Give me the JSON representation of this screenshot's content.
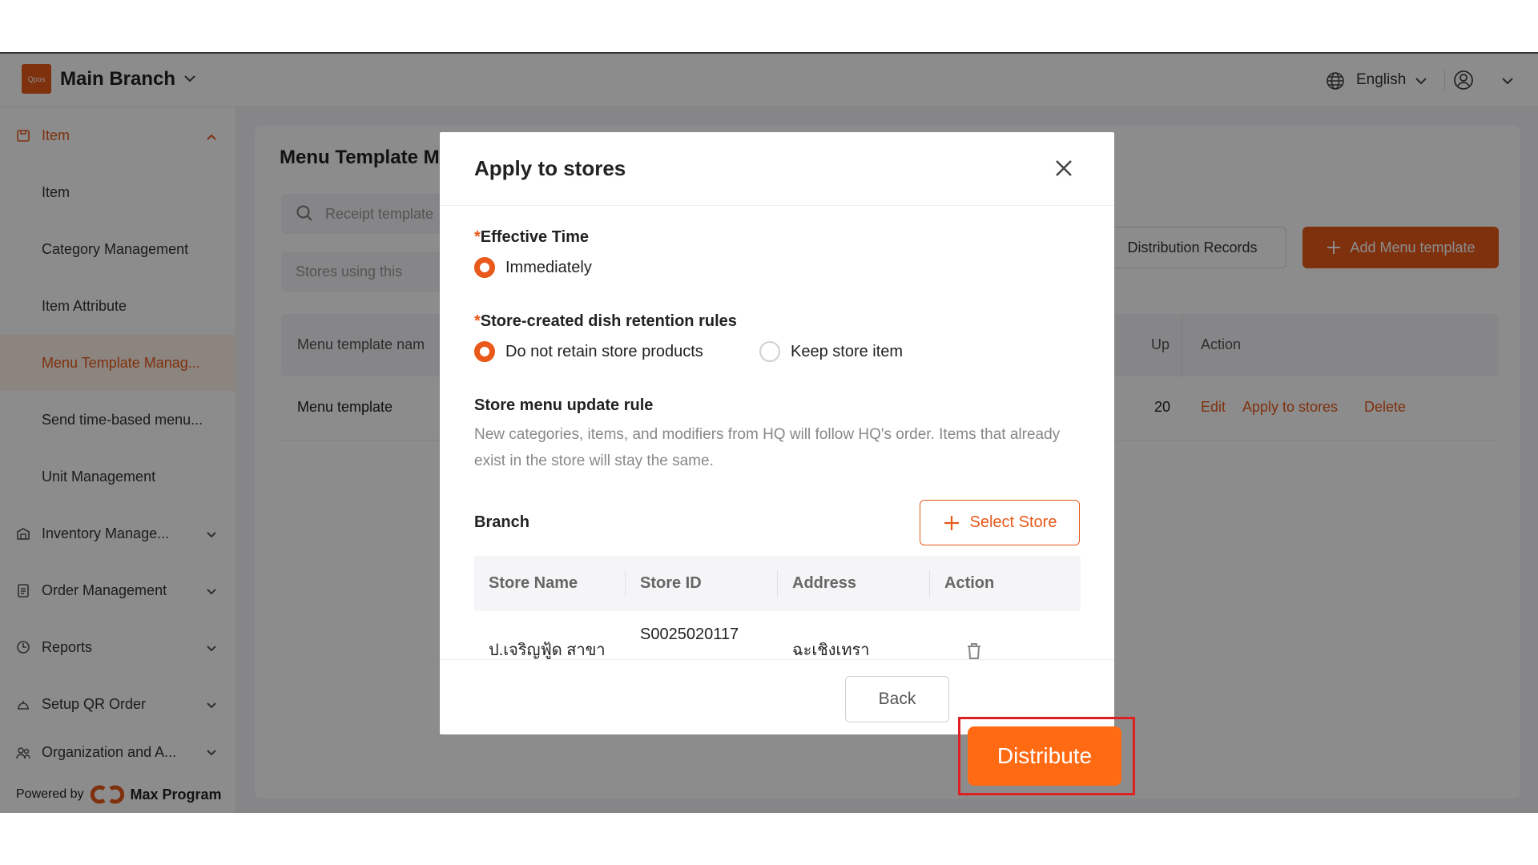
{
  "topbar": {
    "logo_text": "Qpos",
    "branch": "Main Branch",
    "language": "English"
  },
  "sidebar": {
    "items": [
      {
        "label": "Item",
        "icon": "item-icon"
      },
      {
        "label": "Item"
      },
      {
        "label": "Category Management"
      },
      {
        "label": "Item Attribute"
      },
      {
        "label": "Menu Template Manag..."
      },
      {
        "label": "Send time-based menu..."
      },
      {
        "label": "Unit Management"
      },
      {
        "label": "Inventory Manage...",
        "icon": "inventory-icon"
      },
      {
        "label": "Order Management",
        "icon": "order-icon"
      },
      {
        "label": "Reports",
        "icon": "reports-icon"
      },
      {
        "label": "Setup QR Order",
        "icon": "qr-order-icon"
      },
      {
        "label": "Organization and A...",
        "icon": "organization-icon"
      }
    ],
    "powered_by": "Powered by",
    "brand": "Max Program"
  },
  "page": {
    "title": "Menu Template M",
    "search_placeholder": "Receipt template",
    "stores_filter_placeholder": "Stores using this",
    "distribution_records": "Distribution Records",
    "add_button": "Add Menu template",
    "table": {
      "col_name": "Menu template nam",
      "col_updated": "Up",
      "col_action": "Action",
      "row": {
        "name": "Menu template",
        "updated": "20",
        "actions": [
          "Edit",
          "Apply to stores",
          "Delete"
        ]
      }
    }
  },
  "modal": {
    "title": "Apply to stores",
    "effective_time": {
      "required_mark": "*",
      "label": "Effective Time",
      "option": "Immediately"
    },
    "retention": {
      "required_mark": "*",
      "label": "Store-created dish retention rules",
      "options": [
        "Do not retain store products",
        "Keep store item"
      ],
      "selected": "Do not retain store products"
    },
    "update_rule": {
      "label": "Store menu update rule",
      "description": "New categories, items, and modifiers from HQ will follow HQ's order. Items that already exist in the store will stay the same."
    },
    "branch_label": "Branch",
    "select_store": "Select Store",
    "store_table": {
      "headers": [
        "Store Name",
        "Store ID",
        "Address",
        "Action"
      ],
      "row": {
        "name": "ป.เจริญฟู้ด สาขา",
        "store_id": "S0025020117",
        "address": "ฉะเชิงเทรา"
      }
    },
    "back": "Back",
    "distribute": "Distribute"
  },
  "colors": {
    "accent": "#e8591a",
    "distribute": "#ff6a13",
    "highlight": "#e02020"
  }
}
